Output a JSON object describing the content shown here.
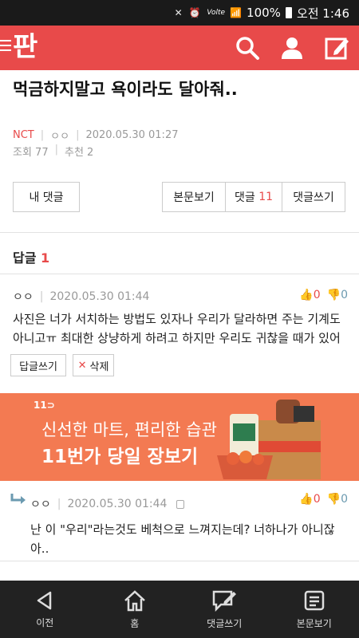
{
  "status_bar": {
    "signal": "Volte",
    "battery": "100%",
    "time": "오전 1:46"
  },
  "header": {
    "logo_text": "판",
    "icons": [
      "menu-icon",
      "search-icon",
      "user-icon",
      "write-icon"
    ]
  },
  "post": {
    "title": "먹금하지말고 욕이라도 달아줘..",
    "category": "NCT",
    "author": "ㅇㅇ",
    "date": "2020.05.30 01:27",
    "views": "조회 77",
    "recommend": "추천 2"
  },
  "buttons": {
    "my_comment": "내 댓글",
    "view_body": "본문보기",
    "comment_label": "댓글",
    "comment_count": "11",
    "write_comment": "댓글쓰기"
  },
  "replies": {
    "label": "답글",
    "count": "1"
  },
  "comment1": {
    "author": "ㅇㅇ",
    "date": "2020.05.30 01:44",
    "up": "0",
    "down": "0",
    "text": "사진은 너가 서치하는 방법도 있자나 우리가 달라하면 주는 기계도 아니고ㅠ 최대한 상냥하게 하려고 하지만 우리도 귀찮을 때가 있어",
    "reply_btn": "답글쓰기",
    "delete_btn": "삭제"
  },
  "banner": {
    "logo": "11⊃",
    "line1": "신선한 마트, 편리한 습관",
    "line2": "11번가 당일 장보기"
  },
  "comment2": {
    "author": "ㅇㅇ",
    "date": "2020.05.30 01:44",
    "up": "0",
    "down": "0",
    "text": "난 이 \"우리\"라는것도 베척으로 느껴지는데? 너하나가 아니잖아.."
  },
  "bottom_nav": [
    {
      "label": "이전",
      "icon": "back-icon"
    },
    {
      "label": "홈",
      "icon": "home-icon"
    },
    {
      "label": "댓글쓰기",
      "icon": "comment-write-icon"
    },
    {
      "label": "본문보기",
      "icon": "article-icon"
    }
  ],
  "colors": {
    "brand": "#e84a4a",
    "banner": "#f37a52",
    "nav": "#222222"
  }
}
